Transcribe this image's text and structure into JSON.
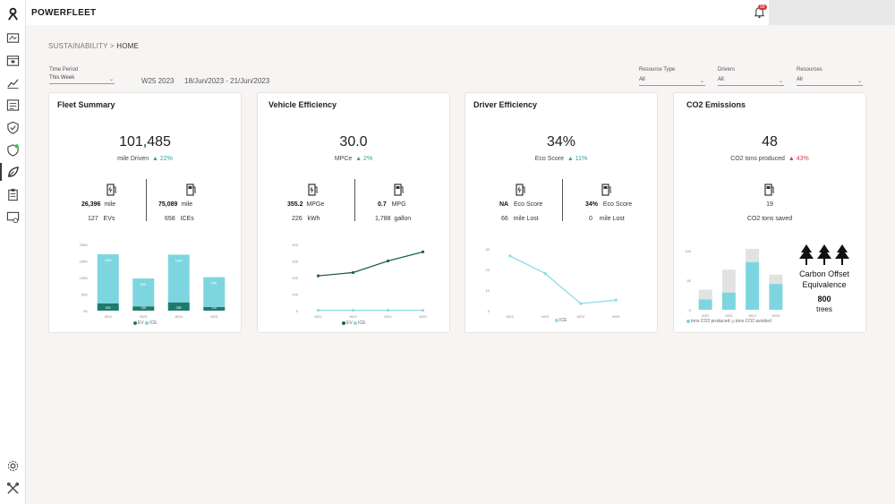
{
  "app": {
    "brand": "POWERFLEET",
    "notification_count": "99"
  },
  "breadcrumb": {
    "section": "SUSTAINABILITY",
    "separator": ">",
    "page": "HOME"
  },
  "filters": {
    "time_period_label": "Time Period",
    "time_period_value": "This Week",
    "week": "W25 2023",
    "date_range": "18/Jun/2023 - 21/Jun/2023",
    "resource_type_label": "Resource Type",
    "resource_type_value": "All",
    "drivers_label": "Drivers",
    "drivers_value": "All",
    "resources_label": "Resources",
    "resources_value": "All"
  },
  "colors": {
    "ev": "#7dd6df",
    "ice": "#1f7a6e",
    "line_ice": "#1f5f57",
    "line_ev": "#8bdde6",
    "accent_up": "#2ea59a",
    "accent_red": "#d04050",
    "co2_produced": "#7dd6df",
    "co2_avoided": "#e2e2e2"
  },
  "fleet_summary": {
    "title": "Fleet Summary",
    "value": "101,485",
    "unit": "mile Driven",
    "delta": "▲ 22%",
    "ev_distance": "26,396",
    "ev_distance_unit": "mile",
    "ev_count": "127",
    "ev_count_unit": "EVs",
    "ice_distance": "75,089",
    "ice_distance_unit": "mile",
    "ice_count": "658",
    "ice_count_unit": "ICEs",
    "legend_ev": "EV",
    "legend_ice": "ICE"
  },
  "vehicle_efficiency": {
    "title": "Vehicle Efficiency",
    "value": "30.0",
    "unit": "MPCe",
    "delta": "▲ 2%",
    "ev_value": "355.2",
    "ev_unit": "MPGe",
    "ev_energy": "226",
    "ev_energy_unit": "kWh",
    "ice_value": "0.7",
    "ice_unit": "MPG",
    "ice_fuel": "1,788",
    "ice_fuel_unit": "gallon",
    "legend_ev": "EV",
    "legend_ice": "ICE"
  },
  "driver_efficiency": {
    "title": "Driver Efficiency",
    "value": "34%",
    "unit": "Eco Score",
    "delta": "▲ 11%",
    "ev_score": "NA",
    "ev_score_unit": "Eco Score",
    "ev_lost": "66",
    "ev_lost_unit": "mile Lost",
    "ice_score": "34%",
    "ice_score_unit": "Eco Score",
    "ice_lost": "0",
    "ice_lost_unit": "mile Lost",
    "legend_ice": "ICE"
  },
  "co2_emissions": {
    "title": "CO2 Emissions",
    "value": "48",
    "unit": "CO2 tons produced",
    "delta": "▲ 43%",
    "saved_value": "19",
    "saved_unit": "CO2 tons saved",
    "offset_title": "Carbon Offset Equivalence",
    "trees_value": "800",
    "trees_unit": "trees",
    "legend_produced": "tons CO2 produced",
    "legend_avoided": "tons CO2 avoided"
  },
  "chart_data": [
    {
      "type": "bar",
      "title": "Fleet Summary",
      "categories": [
        "W22",
        "W23",
        "W24",
        "W25"
      ],
      "yticks": [
        "0K",
        "50K",
        "100K",
        "150K",
        "200K"
      ],
      "ylim": [
        0,
        200000
      ],
      "stacked": true,
      "series": [
        {
          "name": "ICE",
          "values": [
            22000,
            13000,
            25000,
            11000
          ],
          "labels": [
            "22K",
            "13K",
            "25K",
            "11K"
          ]
        },
        {
          "name": "EV",
          "values": [
            148000,
            84000,
            144000,
            90000
          ],
          "labels": [
            "148K",
            "84K",
            "144K",
            "90K"
          ]
        }
      ]
    },
    {
      "type": "line",
      "title": "Vehicle Efficiency",
      "categories": [
        "W22",
        "W23",
        "W24",
        "W25"
      ],
      "yticks": [
        "0",
        "100",
        "200",
        "300",
        "400"
      ],
      "ylim": [
        0,
        400
      ],
      "series": [
        {
          "name": "ICE",
          "values": [
            210,
            230,
            300,
            355
          ]
        },
        {
          "name": "EV",
          "values": [
            2,
            2,
            2,
            2
          ]
        }
      ]
    },
    {
      "type": "line",
      "title": "Driver Efficiency",
      "categories": [
        "W22",
        "W23",
        "W24",
        "W25"
      ],
      "yticks": [
        "0",
        "10",
        "20",
        "30"
      ],
      "ylim": [
        0,
        35
      ],
      "series": [
        {
          "name": "ICE",
          "values": [
            31,
            21,
            4,
            6
          ]
        }
      ]
    },
    {
      "type": "bar",
      "title": "CO2 Emissions",
      "categories": [
        "W22",
        "W23",
        "W24",
        "W25"
      ],
      "yticks": [
        "0",
        "50",
        "100"
      ],
      "ylim": [
        0,
        130
      ],
      "stacked": true,
      "series": [
        {
          "name": "tons CO2 produced",
          "values": [
            23,
            38,
            105,
            57
          ],
          "labels": [
            "",
            "",
            "",
            ""
          ]
        },
        {
          "name": "tons CO2 avoided",
          "values": [
            21,
            50,
            29,
            20
          ],
          "labels": [
            "",
            "",
            "",
            ""
          ]
        }
      ]
    }
  ]
}
